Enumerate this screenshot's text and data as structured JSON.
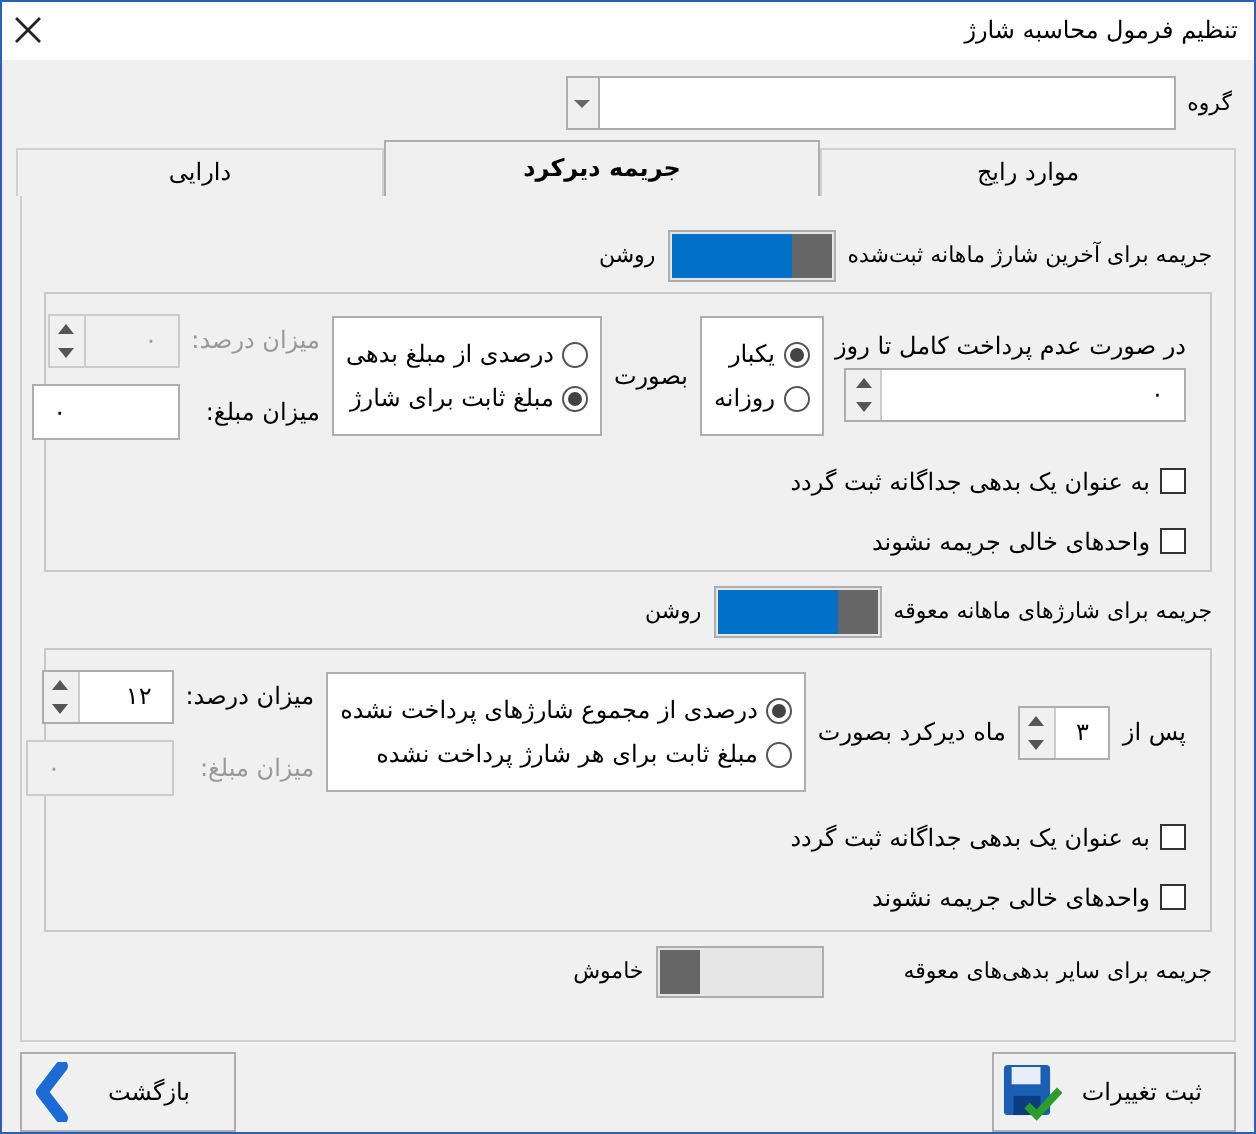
{
  "window": {
    "title": "تنظیم فرمول محاسبه شارژ"
  },
  "group": {
    "label": "گروه"
  },
  "tabs": [
    {
      "label": "موارد رایج",
      "selected": false
    },
    {
      "label": "جریمه دیرکرد",
      "selected": true
    },
    {
      "label": "دارایی",
      "selected": false
    }
  ],
  "last_charge": {
    "toggle": {
      "label": "جریمه برای آخرین شارژ ماهانه ثبت‌شده",
      "state": "روشن",
      "on": true
    },
    "day_label": "در صورت عدم پرداخت کامل تا روز",
    "day_value": "۰",
    "mode_label": "بصورت",
    "mode_options": [
      {
        "label": "یکبار",
        "selected": true
      },
      {
        "label": "روزانه",
        "selected": false
      }
    ],
    "amount_options": [
      {
        "label": "درصدی از مبلغ بدهی",
        "selected": false
      },
      {
        "label": "مبلغ ثابت برای شارژ",
        "selected": true
      }
    ],
    "percent": {
      "label": "میزان درصد:",
      "value": "۰",
      "disabled": true
    },
    "amount": {
      "label": "میزان مبلغ:",
      "value": "۰",
      "disabled": false
    },
    "checkboxes": [
      {
        "label": "به عنوان یک بدهی جداگانه ثبت گردد",
        "checked": false
      },
      {
        "label": "واحدهای خالی جریمه نشوند",
        "checked": false
      }
    ]
  },
  "overdue_charges": {
    "toggle": {
      "label": "جریمه برای شارژهای ماهانه معوقه",
      "state": "روشن",
      "on": true
    },
    "after_label": "پس از",
    "months_value": "۳",
    "months_label": "ماه دیرکرد بصورت",
    "amount_options": [
      {
        "label": "درصدی از مجموع شارژهای پرداخت نشده",
        "selected": true
      },
      {
        "label": "مبلغ ثابت برای هر شارژ پرداخت نشده",
        "selected": false
      }
    ],
    "percent": {
      "label": "میزان درصد:",
      "value": "۱۲",
      "disabled": false
    },
    "amount": {
      "label": "میزان مبلغ:",
      "value": "۰",
      "disabled": true
    },
    "checkboxes": [
      {
        "label": "به عنوان یک بدهی جداگانه ثبت گردد",
        "checked": false
      },
      {
        "label": "واحدهای خالی جریمه نشوند",
        "checked": false
      }
    ]
  },
  "other_debts": {
    "toggle": {
      "label": "جریمه برای سایر بدهی‌های معوقه",
      "state": "خاموش",
      "on": false
    }
  },
  "buttons": {
    "save": "ثبت تغییرات",
    "back": "بازگشت"
  }
}
